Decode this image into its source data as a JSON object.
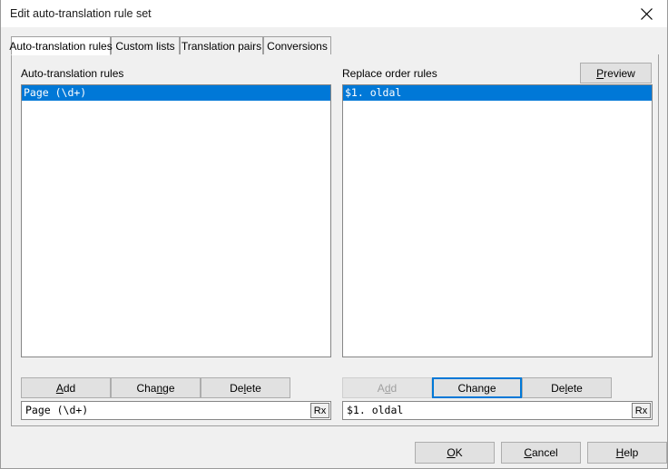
{
  "window": {
    "title": "Edit auto-translation rule set",
    "close_icon": "close-icon"
  },
  "tabs": [
    {
      "label": "Auto-translation rules",
      "active": true
    },
    {
      "label": "Custom lists",
      "active": false
    },
    {
      "label": "Translation pairs",
      "active": false
    },
    {
      "label": "Conversions",
      "active": false
    }
  ],
  "left_panel": {
    "group_label": "Auto-translation rules",
    "list_items": [
      {
        "text": "Page (\\d+)",
        "selected": true
      }
    ],
    "buttons": {
      "add": "Add",
      "add_accel": "A",
      "change": "Change",
      "change_accel": "n",
      "delete": "Delete",
      "delete_accel": "l"
    },
    "field": {
      "value": "Page (\\d+)",
      "rx_label": "Rx"
    }
  },
  "right_panel": {
    "group_label": "Replace order rules",
    "preview_button": "Preview",
    "preview_accel": "P",
    "list_items": [
      {
        "text": "$1. oldal",
        "selected": true
      }
    ],
    "buttons": {
      "add": "Add",
      "add_accel": "d",
      "add_disabled": true,
      "change": "Change",
      "change_accel": "g",
      "change_default": true,
      "delete": "Delete",
      "delete_accel": "l"
    },
    "field": {
      "value": "$1. oldal",
      "rx_label": "Rx"
    }
  },
  "dialog_buttons": {
    "ok": "OK",
    "ok_accel": "O",
    "cancel": "Cancel",
    "cancel_accel": "C",
    "help": "Help",
    "help_accel": "H"
  },
  "colors": {
    "selection": "#0078d7",
    "face": "#f0f0f0",
    "button_face": "#e1e1e1",
    "border": "#a0a0a0",
    "field_border": "#868686"
  }
}
